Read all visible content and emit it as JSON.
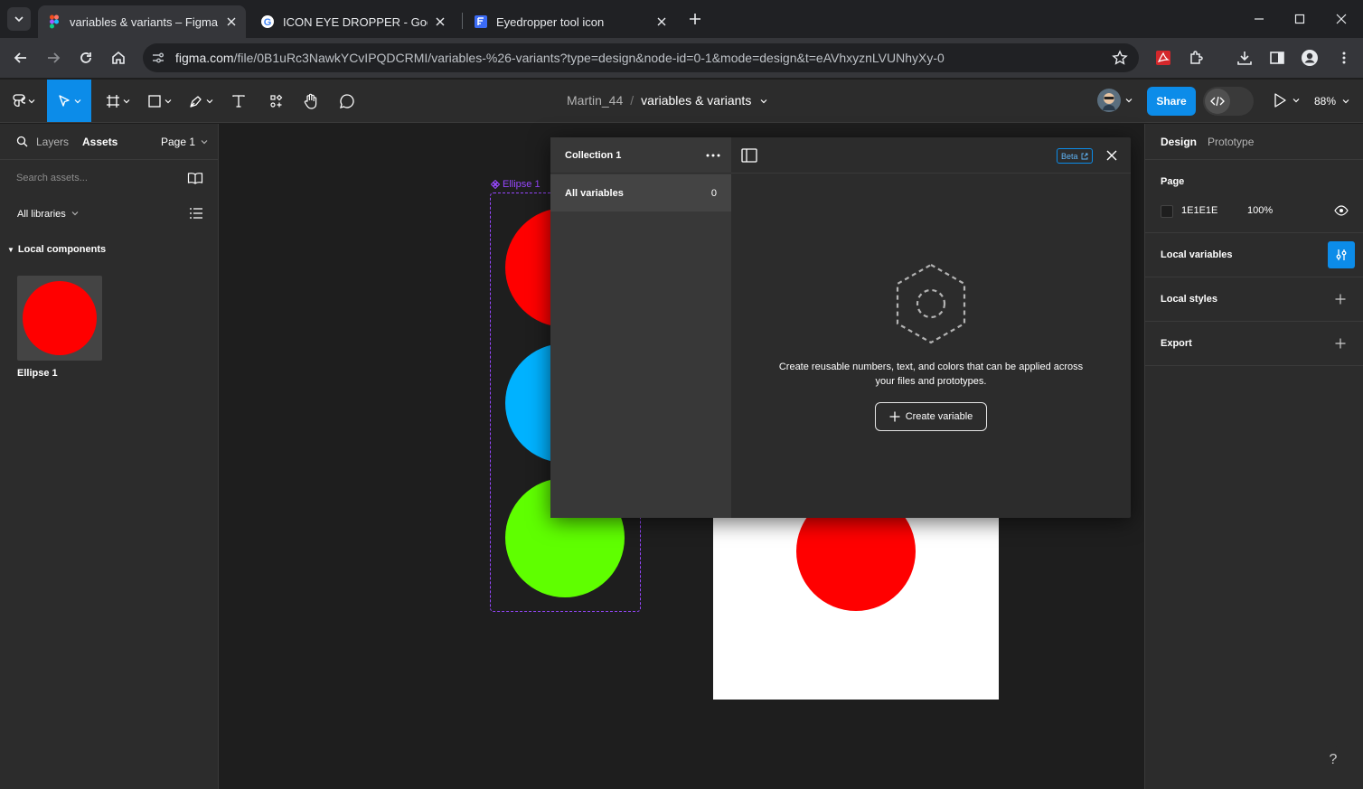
{
  "browser": {
    "tabs": [
      {
        "title": "variables & variants – Figma",
        "active": true
      },
      {
        "title": "ICON EYE DROPPER - Google Search",
        "active": false
      },
      {
        "title": "Eyedropper tool icon",
        "active": false
      }
    ],
    "url_host": "figma.com",
    "url_path": "/file/0B1uRc3NawkYCvIPQDCRMI/variables-%26-variants?type=design&node-id=0-1&mode=design&t=eAVhxyznLVUNhyXy-0"
  },
  "figma": {
    "topbar": {
      "project": "Martin_44",
      "file_name": "variables & variants",
      "share_label": "Share",
      "zoom": "88%"
    },
    "left_panel": {
      "tab_layers": "Layers",
      "tab_assets": "Assets",
      "page_selector": "Page 1",
      "search_placeholder": "Search assets...",
      "libraries": "All libraries",
      "section": "Local components",
      "component_name": "Ellipse 1"
    },
    "canvas": {
      "component_label": "Ellipse 1",
      "colors": {
        "red": "#FF0000",
        "blue": "#00B2FF",
        "green": "#5FFF00"
      }
    },
    "variables_modal": {
      "collection": "Collection 1",
      "all_variables": "All variables",
      "count": "0",
      "beta": "Beta",
      "empty_text": "Create reusable numbers, text, and colors that can be applied across your files and prototypes.",
      "create_button": "Create variable"
    },
    "right_panel": {
      "tab_design": "Design",
      "tab_prototype": "Prototype",
      "page_title": "Page",
      "page_color": "1E1E1E",
      "page_opacity": "100%",
      "local_variables": "Local variables",
      "local_styles": "Local styles",
      "export": "Export"
    },
    "help": "?"
  }
}
